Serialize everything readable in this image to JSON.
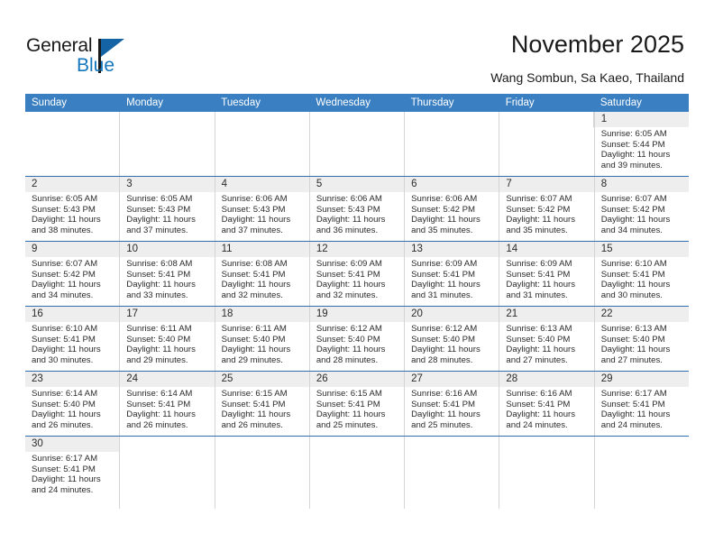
{
  "brand": {
    "name_part1": "General",
    "name_part2": "Blue",
    "triangle_color": "#1464a5",
    "blue_color": "#1476bd"
  },
  "header": {
    "title": "November 2025",
    "subtitle": "Wang Sombun, Sa Kaeo, Thailand",
    "accent_color": "#3a7fc1",
    "numband_color": "#eeeeee"
  },
  "weekdays": [
    "Sunday",
    "Monday",
    "Tuesday",
    "Wednesday",
    "Thursday",
    "Friday",
    "Saturday"
  ],
  "calendar": {
    "month": "November",
    "year": 2025,
    "weeks": [
      [
        {
          "day": ""
        },
        {
          "day": ""
        },
        {
          "day": ""
        },
        {
          "day": ""
        },
        {
          "day": ""
        },
        {
          "day": ""
        },
        {
          "day": "1",
          "sunrise": "Sunrise: 6:05 AM",
          "sunset": "Sunset: 5:44 PM",
          "daylight1": "Daylight: 11 hours",
          "daylight2": "and 39 minutes."
        }
      ],
      [
        {
          "day": "2",
          "sunrise": "Sunrise: 6:05 AM",
          "sunset": "Sunset: 5:43 PM",
          "daylight1": "Daylight: 11 hours",
          "daylight2": "and 38 minutes."
        },
        {
          "day": "3",
          "sunrise": "Sunrise: 6:05 AM",
          "sunset": "Sunset: 5:43 PM",
          "daylight1": "Daylight: 11 hours",
          "daylight2": "and 37 minutes."
        },
        {
          "day": "4",
          "sunrise": "Sunrise: 6:06 AM",
          "sunset": "Sunset: 5:43 PM",
          "daylight1": "Daylight: 11 hours",
          "daylight2": "and 37 minutes."
        },
        {
          "day": "5",
          "sunrise": "Sunrise: 6:06 AM",
          "sunset": "Sunset: 5:43 PM",
          "daylight1": "Daylight: 11 hours",
          "daylight2": "and 36 minutes."
        },
        {
          "day": "6",
          "sunrise": "Sunrise: 6:06 AM",
          "sunset": "Sunset: 5:42 PM",
          "daylight1": "Daylight: 11 hours",
          "daylight2": "and 35 minutes."
        },
        {
          "day": "7",
          "sunrise": "Sunrise: 6:07 AM",
          "sunset": "Sunset: 5:42 PM",
          "daylight1": "Daylight: 11 hours",
          "daylight2": "and 35 minutes."
        },
        {
          "day": "8",
          "sunrise": "Sunrise: 6:07 AM",
          "sunset": "Sunset: 5:42 PM",
          "daylight1": "Daylight: 11 hours",
          "daylight2": "and 34 minutes."
        }
      ],
      [
        {
          "day": "9",
          "sunrise": "Sunrise: 6:07 AM",
          "sunset": "Sunset: 5:42 PM",
          "daylight1": "Daylight: 11 hours",
          "daylight2": "and 34 minutes."
        },
        {
          "day": "10",
          "sunrise": "Sunrise: 6:08 AM",
          "sunset": "Sunset: 5:41 PM",
          "daylight1": "Daylight: 11 hours",
          "daylight2": "and 33 minutes."
        },
        {
          "day": "11",
          "sunrise": "Sunrise: 6:08 AM",
          "sunset": "Sunset: 5:41 PM",
          "daylight1": "Daylight: 11 hours",
          "daylight2": "and 32 minutes."
        },
        {
          "day": "12",
          "sunrise": "Sunrise: 6:09 AM",
          "sunset": "Sunset: 5:41 PM",
          "daylight1": "Daylight: 11 hours",
          "daylight2": "and 32 minutes."
        },
        {
          "day": "13",
          "sunrise": "Sunrise: 6:09 AM",
          "sunset": "Sunset: 5:41 PM",
          "daylight1": "Daylight: 11 hours",
          "daylight2": "and 31 minutes."
        },
        {
          "day": "14",
          "sunrise": "Sunrise: 6:09 AM",
          "sunset": "Sunset: 5:41 PM",
          "daylight1": "Daylight: 11 hours",
          "daylight2": "and 31 minutes."
        },
        {
          "day": "15",
          "sunrise": "Sunrise: 6:10 AM",
          "sunset": "Sunset: 5:41 PM",
          "daylight1": "Daylight: 11 hours",
          "daylight2": "and 30 minutes."
        }
      ],
      [
        {
          "day": "16",
          "sunrise": "Sunrise: 6:10 AM",
          "sunset": "Sunset: 5:41 PM",
          "daylight1": "Daylight: 11 hours",
          "daylight2": "and 30 minutes."
        },
        {
          "day": "17",
          "sunrise": "Sunrise: 6:11 AM",
          "sunset": "Sunset: 5:40 PM",
          "daylight1": "Daylight: 11 hours",
          "daylight2": "and 29 minutes."
        },
        {
          "day": "18",
          "sunrise": "Sunrise: 6:11 AM",
          "sunset": "Sunset: 5:40 PM",
          "daylight1": "Daylight: 11 hours",
          "daylight2": "and 29 minutes."
        },
        {
          "day": "19",
          "sunrise": "Sunrise: 6:12 AM",
          "sunset": "Sunset: 5:40 PM",
          "daylight1": "Daylight: 11 hours",
          "daylight2": "and 28 minutes."
        },
        {
          "day": "20",
          "sunrise": "Sunrise: 6:12 AM",
          "sunset": "Sunset: 5:40 PM",
          "daylight1": "Daylight: 11 hours",
          "daylight2": "and 28 minutes."
        },
        {
          "day": "21",
          "sunrise": "Sunrise: 6:13 AM",
          "sunset": "Sunset: 5:40 PM",
          "daylight1": "Daylight: 11 hours",
          "daylight2": "and 27 minutes."
        },
        {
          "day": "22",
          "sunrise": "Sunrise: 6:13 AM",
          "sunset": "Sunset: 5:40 PM",
          "daylight1": "Daylight: 11 hours",
          "daylight2": "and 27 minutes."
        }
      ],
      [
        {
          "day": "23",
          "sunrise": "Sunrise: 6:14 AM",
          "sunset": "Sunset: 5:40 PM",
          "daylight1": "Daylight: 11 hours",
          "daylight2": "and 26 minutes."
        },
        {
          "day": "24",
          "sunrise": "Sunrise: 6:14 AM",
          "sunset": "Sunset: 5:41 PM",
          "daylight1": "Daylight: 11 hours",
          "daylight2": "and 26 minutes."
        },
        {
          "day": "25",
          "sunrise": "Sunrise: 6:15 AM",
          "sunset": "Sunset: 5:41 PM",
          "daylight1": "Daylight: 11 hours",
          "daylight2": "and 26 minutes."
        },
        {
          "day": "26",
          "sunrise": "Sunrise: 6:15 AM",
          "sunset": "Sunset: 5:41 PM",
          "daylight1": "Daylight: 11 hours",
          "daylight2": "and 25 minutes."
        },
        {
          "day": "27",
          "sunrise": "Sunrise: 6:16 AM",
          "sunset": "Sunset: 5:41 PM",
          "daylight1": "Daylight: 11 hours",
          "daylight2": "and 25 minutes."
        },
        {
          "day": "28",
          "sunrise": "Sunrise: 6:16 AM",
          "sunset": "Sunset: 5:41 PM",
          "daylight1": "Daylight: 11 hours",
          "daylight2": "and 24 minutes."
        },
        {
          "day": "29",
          "sunrise": "Sunrise: 6:17 AM",
          "sunset": "Sunset: 5:41 PM",
          "daylight1": "Daylight: 11 hours",
          "daylight2": "and 24 minutes."
        }
      ],
      [
        {
          "day": "30",
          "sunrise": "Sunrise: 6:17 AM",
          "sunset": "Sunset: 5:41 PM",
          "daylight1": "Daylight: 11 hours",
          "daylight2": "and 24 minutes."
        },
        {
          "day": ""
        },
        {
          "day": ""
        },
        {
          "day": ""
        },
        {
          "day": ""
        },
        {
          "day": ""
        },
        {
          "day": ""
        }
      ]
    ]
  }
}
